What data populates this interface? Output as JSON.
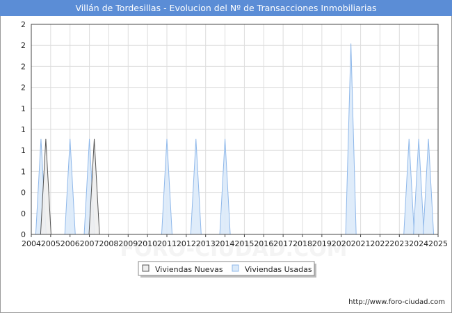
{
  "title": "Villán de Tordesillas - Evolucion del Nº de Transacciones Inmobiliarias",
  "watermark": "FORO-CIUDAD.COM",
  "source_url": "http://www.foro-ciudad.com",
  "colors": {
    "title_bg": "#5b8dd6",
    "nuevas_fill": "#eeeeee",
    "nuevas_stroke": "#555555",
    "usadas_fill": "#dbeaf9",
    "usadas_stroke": "#8fb8ea",
    "grid": "#dddddd"
  },
  "chart_data": {
    "type": "area",
    "x_ticks": [
      2004,
      2005,
      2006,
      2007,
      2008,
      2009,
      2010,
      2011,
      2012,
      2013,
      2014,
      2015,
      2016,
      2017,
      2018,
      2019,
      2020,
      2021,
      2022,
      2023,
      2024,
      2025
    ],
    "y_tick_labels": [
      "0",
      "0",
      "0",
      "1",
      "1",
      "1",
      "1",
      "2",
      "2",
      "2",
      "2"
    ],
    "ylim": [
      0,
      2.2
    ],
    "xlim": [
      2004,
      2025
    ],
    "grid": true,
    "legend_position": "bottom-center",
    "series": [
      {
        "name": "Viviendas Nuevas",
        "points": [
          [
            2004.75,
            1
          ],
          [
            2007.25,
            1
          ]
        ]
      },
      {
        "name": "Viviendas Usadas",
        "points": [
          [
            2004.5,
            1
          ],
          [
            2006.0,
            1
          ],
          [
            2007.0,
            1
          ],
          [
            2011.0,
            1
          ],
          [
            2012.5,
            1
          ],
          [
            2014.0,
            1
          ],
          [
            2020.5,
            2
          ],
          [
            2023.5,
            1
          ],
          [
            2024.0,
            1
          ],
          [
            2024.5,
            1
          ]
        ]
      }
    ]
  }
}
